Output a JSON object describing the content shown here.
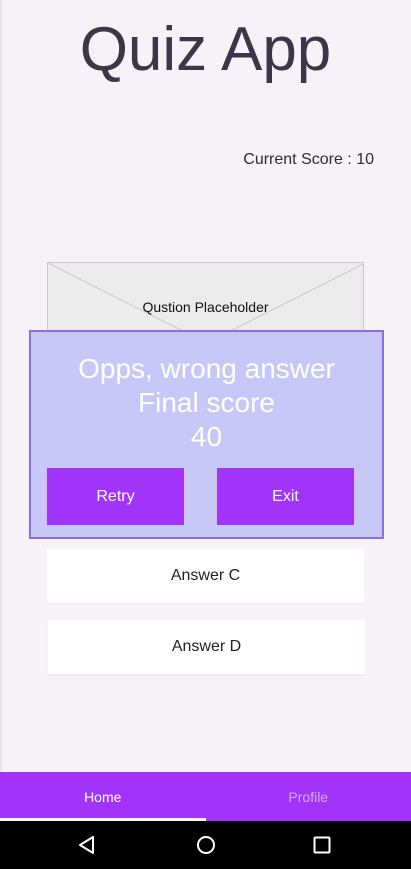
{
  "header": {
    "title": "Quiz App",
    "score_text": "Current Score : 10"
  },
  "question": {
    "placeholder": "Qustion Placeholder"
  },
  "answers": [
    {
      "label": "Answer C"
    },
    {
      "label": "Answer D"
    }
  ],
  "dialog": {
    "line1": "Opps, wrong answer",
    "line2": "Final score",
    "line3": "40",
    "retry_label": "Retry",
    "exit_label": "Exit"
  },
  "bottom_nav": {
    "tabs": [
      {
        "label": "Home",
        "active": true
      },
      {
        "label": "Profile",
        "active": false
      }
    ]
  },
  "colors": {
    "accent": "#a234fa",
    "dialog_bg": "#c8c8f8",
    "dialog_border": "#8e6ee8"
  },
  "icons": [
    "back-icon",
    "home-circle-icon",
    "recents-icon"
  ]
}
